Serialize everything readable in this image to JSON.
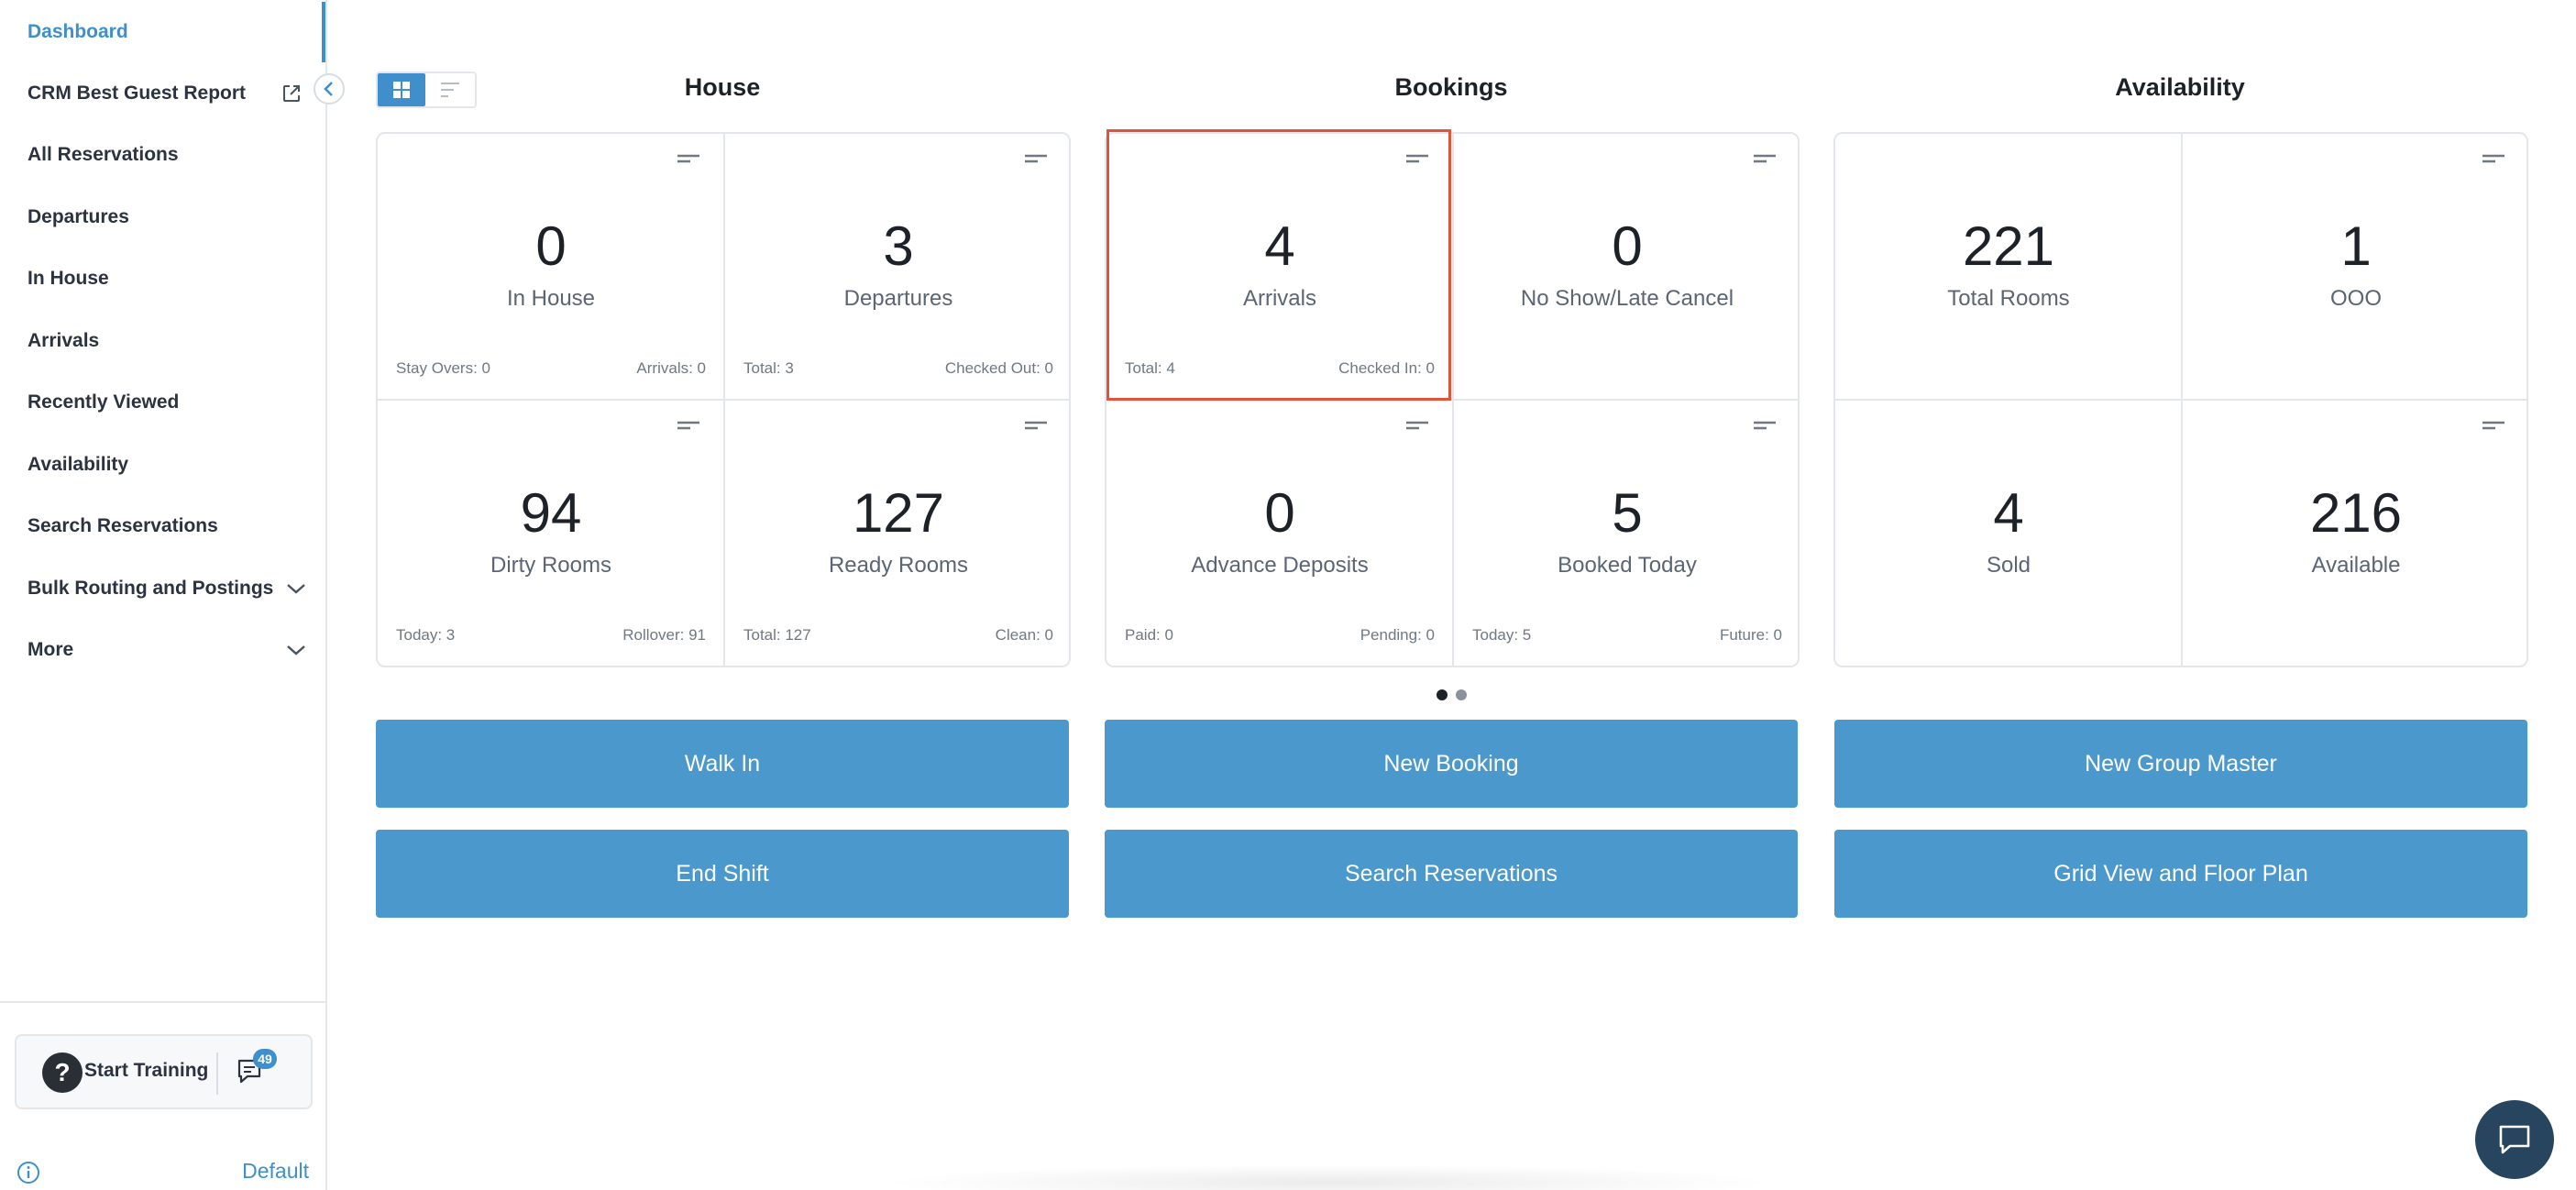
{
  "sidebar": {
    "items": [
      {
        "label": "Dashboard"
      },
      {
        "label": "CRM Best Guest Report"
      },
      {
        "label": "All Reservations"
      },
      {
        "label": "Departures"
      },
      {
        "label": "In House"
      },
      {
        "label": "Arrivals"
      },
      {
        "label": "Recently Viewed"
      },
      {
        "label": "Availability"
      },
      {
        "label": "Search Reservations"
      },
      {
        "label": "Bulk Routing and Postings"
      },
      {
        "label": "More"
      }
    ],
    "training_label": "Start Training",
    "chat_badge": "49",
    "default_label": "Default"
  },
  "sections": {
    "house": "House",
    "bookings": "Bookings",
    "availability": "Availability"
  },
  "tiles": {
    "in_house": {
      "value": "0",
      "label": "In House",
      "foot_left": "Stay Overs: 0",
      "foot_right": "Arrivals: 0"
    },
    "departures": {
      "value": "3",
      "label": "Departures",
      "foot_left": "Total: 3",
      "foot_right": "Checked Out: 0"
    },
    "dirty_rooms": {
      "value": "94",
      "label": "Dirty Rooms",
      "foot_left": "Today: 3",
      "foot_right": "Rollover: 91"
    },
    "ready_rooms": {
      "value": "127",
      "label": "Ready Rooms",
      "foot_left": "Total: 127",
      "foot_right": "Clean: 0"
    },
    "arrivals": {
      "value": "4",
      "label": "Arrivals",
      "foot_left": "Total: 4",
      "foot_right": "Checked In: 0"
    },
    "no_show": {
      "value": "0",
      "label": "No Show/Late Cancel"
    },
    "advance_deposits": {
      "value": "0",
      "label": "Advance Deposits",
      "foot_left": "Paid: 0",
      "foot_right": "Pending: 0"
    },
    "booked_today": {
      "value": "5",
      "label": "Booked Today",
      "foot_left": "Today: 5",
      "foot_right": "Future: 0"
    },
    "total_rooms": {
      "value": "221",
      "label": "Total Rooms"
    },
    "ooo": {
      "value": "1",
      "label": "OOO"
    },
    "sold": {
      "value": "4",
      "label": "Sold"
    },
    "available": {
      "value": "216",
      "label": "Available"
    }
  },
  "actions": {
    "walk_in": "Walk In",
    "new_booking": "New Booking",
    "new_group_master": "New Group Master",
    "end_shift": "End Shift",
    "search_reservations": "Search Reservations",
    "grid_view": "Grid View and Floor Plan"
  },
  "colors": {
    "accent": "#3e8fcb",
    "button": "#4a98cc",
    "highlight": "#e0553a",
    "fab": "#27455e"
  }
}
